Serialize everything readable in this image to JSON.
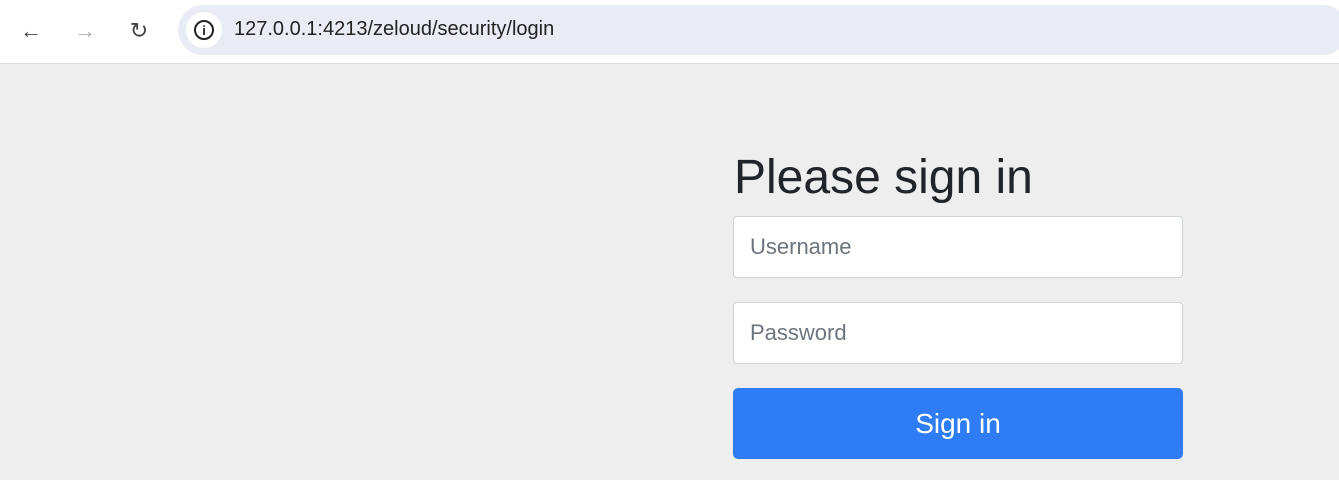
{
  "browser": {
    "url": "127.0.0.1:4213/zeloud/security/login",
    "back_icon": "←",
    "forward_icon": "→",
    "reload_icon": "↻",
    "info_icon": "i"
  },
  "form": {
    "title": "Please sign in",
    "username_placeholder": "Username",
    "password_placeholder": "Password",
    "submit_label": "Sign in"
  },
  "colors": {
    "accent": "#2f7df6",
    "background": "#eeeeee"
  }
}
